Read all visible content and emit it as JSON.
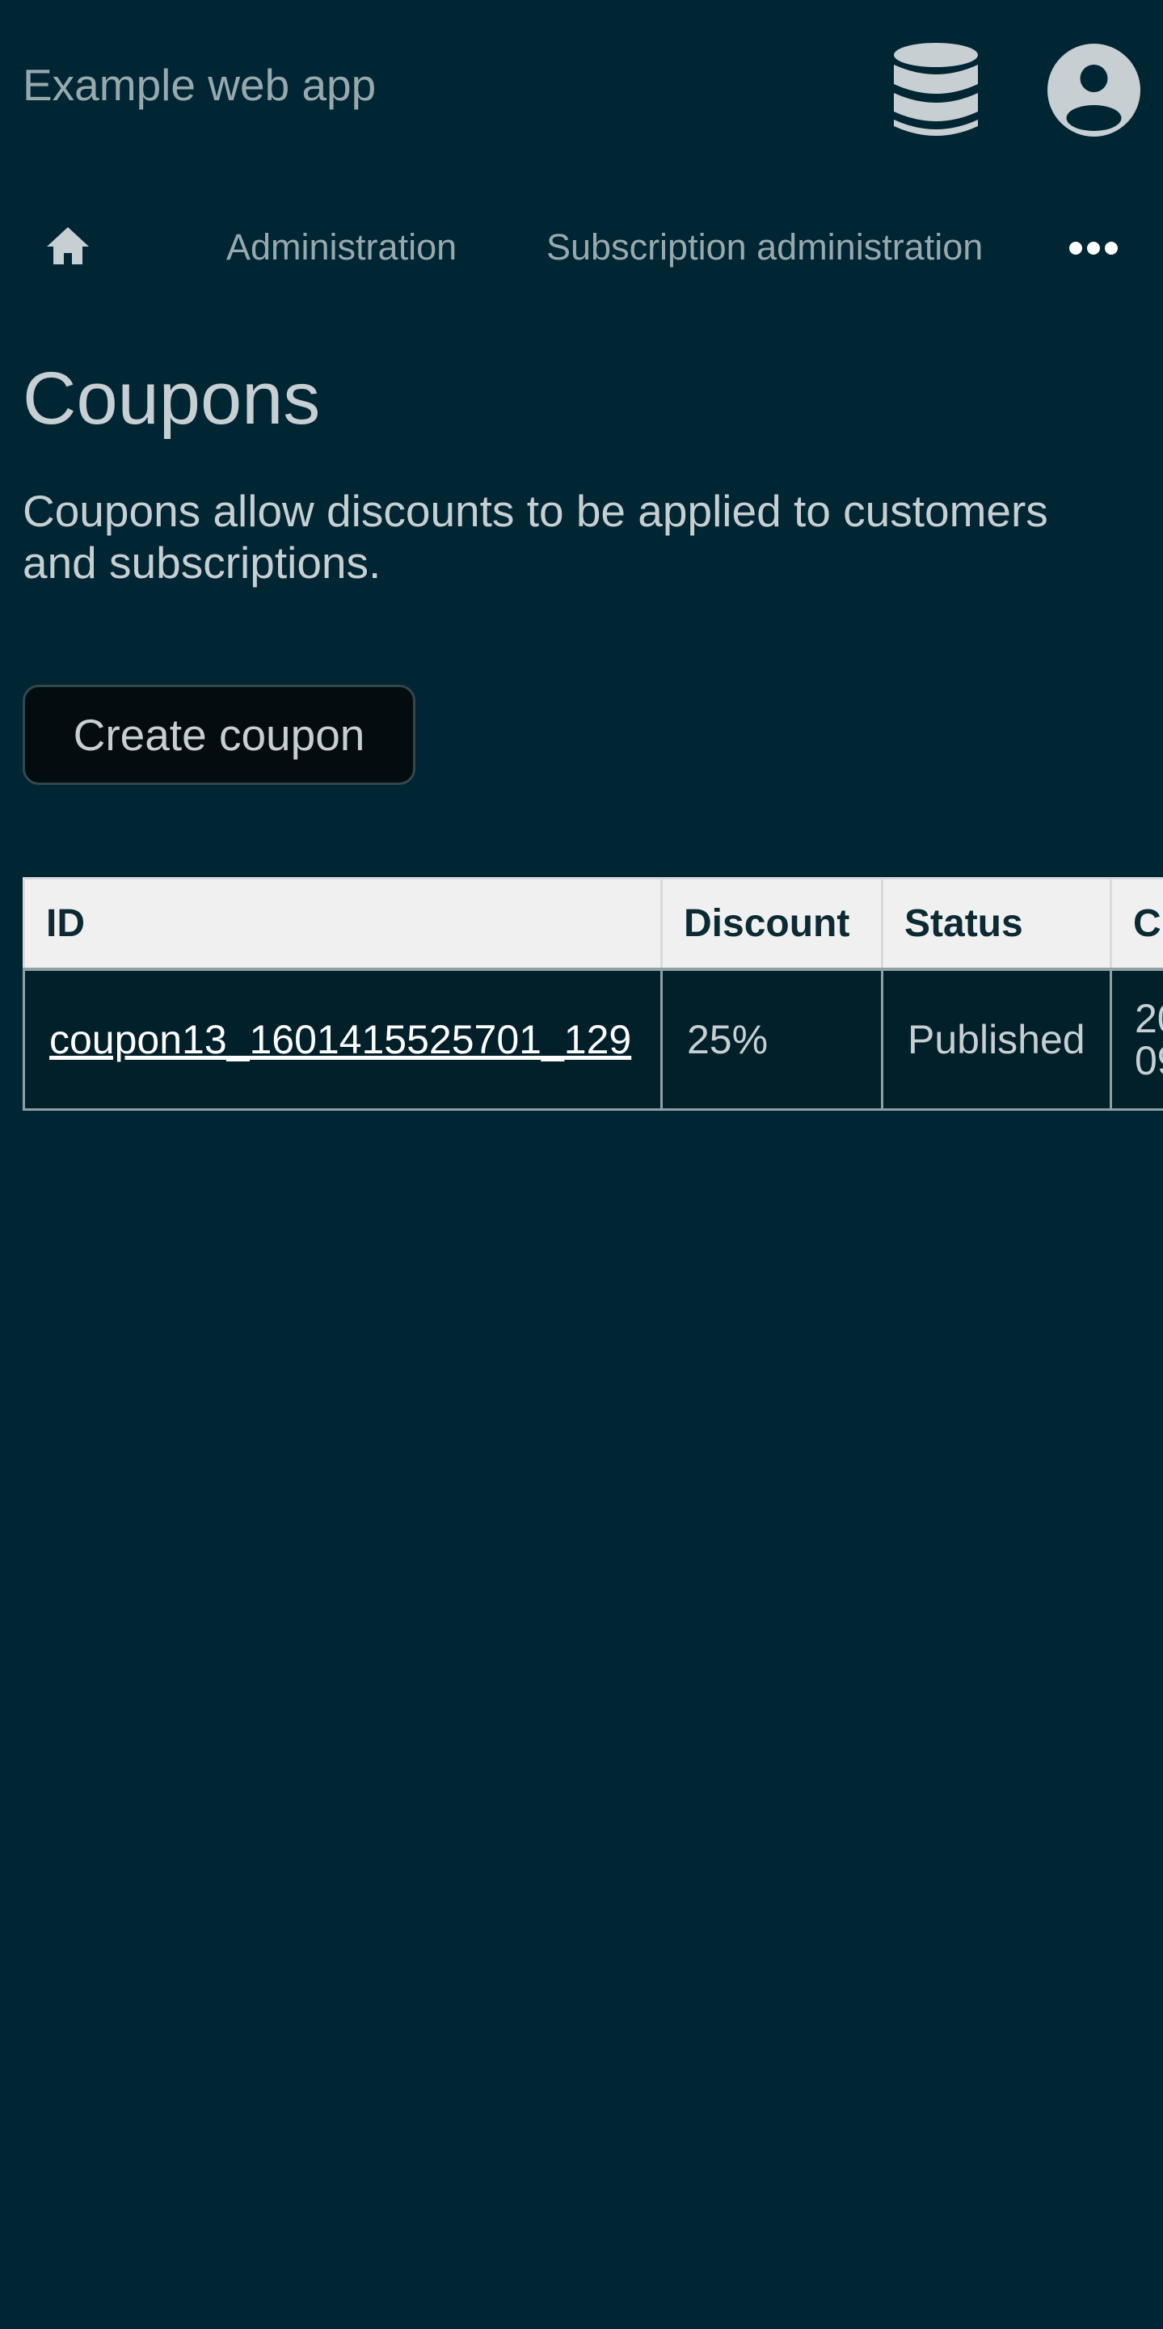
{
  "header": {
    "app_title": "Example web app",
    "icons": [
      "database-icon",
      "user-account-icon"
    ]
  },
  "nav": {
    "home_icon": "home-icon",
    "items": [
      {
        "label": "Administration"
      },
      {
        "label": "Subscription administration"
      }
    ],
    "more_icon": "more-horizontal-icon"
  },
  "page": {
    "title": "Coupons",
    "description": "Coupons allow discounts to be applied to customers and subscriptions.",
    "create_button_label": "Create coupon"
  },
  "table": {
    "columns": [
      "ID",
      "Discount",
      "Status",
      "C"
    ],
    "rows": [
      {
        "id": "coupon13_1601415525701_129",
        "discount": "25%",
        "status": "Published",
        "created_line1": "20",
        "created_line2": "09"
      }
    ]
  },
  "colors": {
    "background": "#002633",
    "text": "#c7cfd2",
    "muted_text": "#98a9ae",
    "table_header_bg": "#f0f0f0",
    "table_header_text": "#0c2a33",
    "button_bg": "#030d10"
  }
}
